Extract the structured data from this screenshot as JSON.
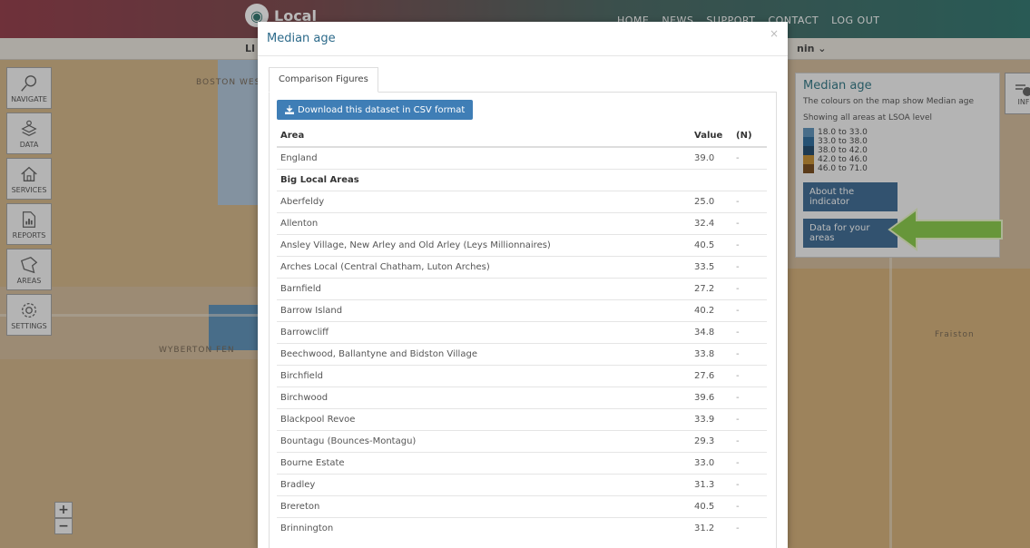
{
  "app": {
    "brand_name": "Local",
    "nav": [
      "HOME",
      "NEWS",
      "SUPPORT",
      "CONTACT",
      "LOG OUT"
    ],
    "subbar_left": "LI -",
    "subbar_right": "nin ⌄"
  },
  "toolbar": [
    {
      "label": "NAVIGATE",
      "icon": "search-icon"
    },
    {
      "label": "DATA",
      "icon": "layers-icon"
    },
    {
      "label": "SERVICES",
      "icon": "home-icon"
    },
    {
      "label": "REPORTS",
      "icon": "report-icon"
    },
    {
      "label": "AREAS",
      "icon": "polygon-icon"
    },
    {
      "label": "SETTINGS",
      "icon": "gear-icon"
    }
  ],
  "map_labels": {
    "boston_west": "BOSTON WEST",
    "wyberton_fen": "WYBERTON FEN",
    "fraiston": "Fraiston"
  },
  "legend": {
    "title": "Median age",
    "description": "The colours on the map show Median age",
    "level": "Showing all areas at LSOA level",
    "ranges": [
      {
        "label": "18.0 to 33.0",
        "color": "#4f88b3"
      },
      {
        "label": "33.0 to 38.0",
        "color": "#1b5f93"
      },
      {
        "label": "38.0 to 42.0",
        "color": "#0d3a5e"
      },
      {
        "label": "42.0 to 46.0",
        "color": "#c1841f"
      },
      {
        "label": "46.0 to 71.0",
        "color": "#6a3b08"
      }
    ],
    "about_button": "About the indicator",
    "data_button": "Data for your areas"
  },
  "info_button": "INF",
  "zoom": {
    "in": "+",
    "out": "−"
  },
  "modal": {
    "title": "Median age",
    "close": "×",
    "tab": "Comparison Figures",
    "download_label": "Download this dataset in CSV format",
    "columns": {
      "area": "Area",
      "value": "Value",
      "n": "(N)"
    },
    "rows": [
      {
        "area": "England",
        "value": "39.0",
        "n": "-",
        "group": false
      },
      {
        "area": "Big Local Areas",
        "value": "",
        "n": "",
        "group": true
      },
      {
        "area": "Aberfeldy",
        "value": "25.0",
        "n": "-",
        "group": false
      },
      {
        "area": "Allenton",
        "value": "32.4",
        "n": "-",
        "group": false
      },
      {
        "area": "Ansley Village, New Arley and Old Arley (Leys Millionnaires)",
        "value": "40.5",
        "n": "-",
        "group": false
      },
      {
        "area": "Arches Local (Central Chatham, Luton Arches)",
        "value": "33.5",
        "n": "-",
        "group": false
      },
      {
        "area": "Barnfield",
        "value": "27.2",
        "n": "-",
        "group": false
      },
      {
        "area": "Barrow Island",
        "value": "40.2",
        "n": "-",
        "group": false
      },
      {
        "area": "Barrowcliff",
        "value": "34.8",
        "n": "-",
        "group": false
      },
      {
        "area": "Beechwood, Ballantyne and Bidston Village",
        "value": "33.8",
        "n": "-",
        "group": false
      },
      {
        "area": "Birchfield",
        "value": "27.6",
        "n": "-",
        "group": false
      },
      {
        "area": "Birchwood",
        "value": "39.6",
        "n": "-",
        "group": false
      },
      {
        "area": "Blackpool Revoe",
        "value": "33.9",
        "n": "-",
        "group": false
      },
      {
        "area": "Bountagu (Bounces-Montagu)",
        "value": "29.3",
        "n": "-",
        "group": false
      },
      {
        "area": "Bourne Estate",
        "value": "33.0",
        "n": "-",
        "group": false
      },
      {
        "area": "Bradley",
        "value": "31.3",
        "n": "-",
        "group": false
      },
      {
        "area": "Brereton",
        "value": "40.5",
        "n": "-",
        "group": false
      },
      {
        "area": "Brinnington",
        "value": "31.2",
        "n": "-",
        "group": false
      }
    ]
  }
}
